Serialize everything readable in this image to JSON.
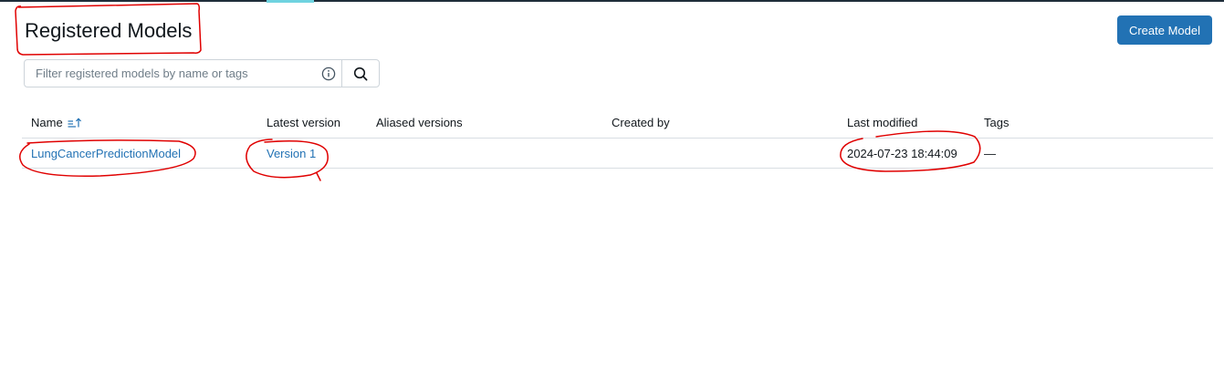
{
  "page": {
    "title": "Registered Models"
  },
  "toolbar": {
    "create_label": "Create Model"
  },
  "search": {
    "placeholder": "Filter registered models by name or tags"
  },
  "table": {
    "headers": {
      "name": "Name",
      "latest_version": "Latest version",
      "aliased_versions": "Aliased versions",
      "created_by": "Created by",
      "last_modified": "Last modified",
      "tags": "Tags"
    },
    "rows": [
      {
        "name": "LungCancerPredictionModel",
        "latest_version": "Version 1",
        "aliased_versions": "",
        "created_by": "",
        "last_modified": "2024-07-23 18:44:09",
        "tags": "—"
      }
    ]
  },
  "colors": {
    "accent": "#2272b4",
    "annotation": "#e00000",
    "topbar": "#1f2d3a"
  },
  "icons": {
    "info": "info-icon",
    "search": "search-icon",
    "sort": "sort-ascending-icon"
  }
}
